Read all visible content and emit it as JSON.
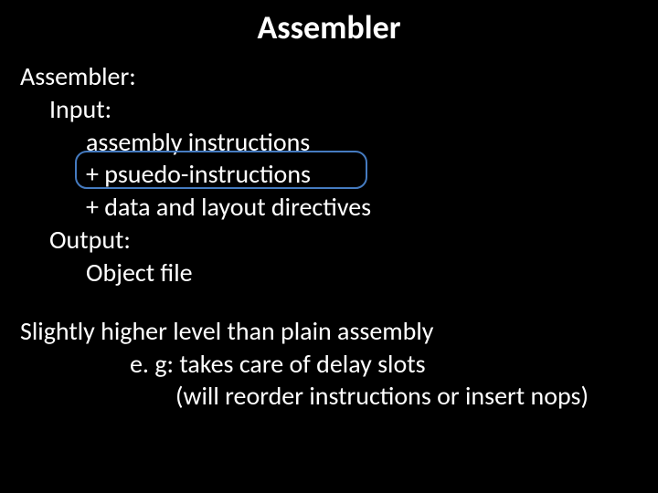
{
  "title": "Assembler",
  "block1": {
    "heading": "Assembler:",
    "input_label": "Input:",
    "input_line1": "assembly instructions",
    "input_line2": "+ psuedo-instructions",
    "input_line3": "+ data and layout directives",
    "output_label": "Output:",
    "output_line1": "Object file"
  },
  "block2": {
    "line1": "Slightly higher level than plain assembly",
    "line2": "e. g: takes care of delay slots",
    "line3": "(will reorder instructions or insert nops)"
  }
}
